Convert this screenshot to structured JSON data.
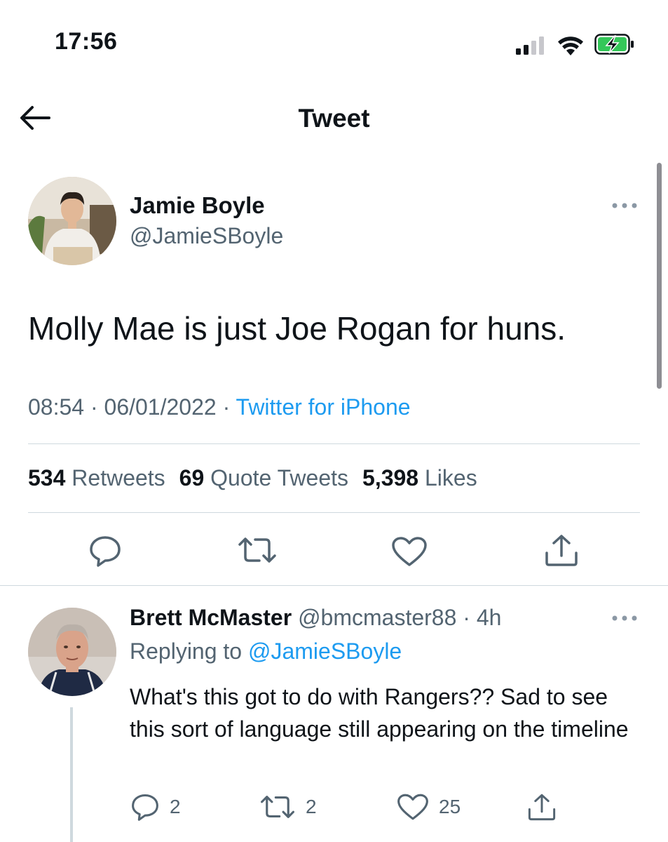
{
  "status_bar": {
    "time": "17:56",
    "icons": [
      "signal-icon",
      "wifi-icon",
      "battery-charging-icon"
    ]
  },
  "header": {
    "title": "Tweet",
    "back_icon": "back-arrow-icon"
  },
  "tweet": {
    "author_name": "Jamie Boyle",
    "author_handle": "@JamieSBoyle",
    "text": "Molly Mae is just Joe Rogan for huns.",
    "time": "08:54",
    "date": "06/01/2022",
    "source": "Twitter for iPhone",
    "retweets_count": "534",
    "retweets_label": "Retweets",
    "quotes_count": "69",
    "quotes_label": "Quote Tweets",
    "likes_count": "5,398",
    "likes_label": "Likes"
  },
  "reply": {
    "author_name": "Brett McMaster",
    "author_handle": "@bmcmaster88",
    "age": "4h",
    "replying_label": "Replying to",
    "replying_to": "@JamieSBoyle",
    "text": "What's this got to do with Rangers?? Sad to see this sort of language still appearing on the timeline",
    "replies_count": "2",
    "retweets_count": "2",
    "likes_count": "25"
  },
  "colors": {
    "text_primary": "#0f1419",
    "text_secondary": "#536471",
    "link": "#1d9bf0",
    "divider": "#cfd9de",
    "battery_fill": "#34c759"
  }
}
